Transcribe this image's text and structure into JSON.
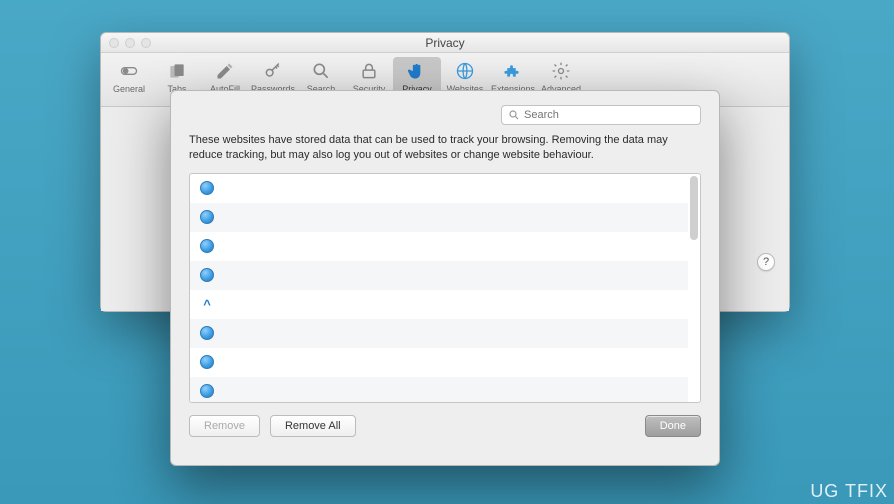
{
  "window": {
    "title": "Privacy"
  },
  "toolbar": {
    "items": [
      {
        "label": "General"
      },
      {
        "label": "Tabs"
      },
      {
        "label": "AutoFill"
      },
      {
        "label": "Passwords"
      },
      {
        "label": "Search"
      },
      {
        "label": "Security"
      },
      {
        "label": "Privacy"
      },
      {
        "label": "Websites"
      },
      {
        "label": "Extensions"
      },
      {
        "label": "Advanced"
      }
    ],
    "selected_index": 6
  },
  "help": {
    "label": "?"
  },
  "sheet": {
    "search": {
      "placeholder": "Search"
    },
    "description": "These websites have stored data that can be used to track your browsing. Removing the data may reduce tracking, but may also log you out of websites or change website behaviour.",
    "rows": [
      {
        "icon": "globe",
        "text": ""
      },
      {
        "icon": "globe",
        "text": ""
      },
      {
        "icon": "globe",
        "text": ""
      },
      {
        "icon": "globe",
        "text": ""
      },
      {
        "icon": "caret",
        "text": ""
      },
      {
        "icon": "globe",
        "text": ""
      },
      {
        "icon": "globe",
        "text": ""
      },
      {
        "icon": "globe",
        "text": ""
      }
    ],
    "buttons": {
      "remove": "Remove",
      "remove_all": "Remove All",
      "done": "Done"
    }
  },
  "watermark": "UG  TFIX"
}
